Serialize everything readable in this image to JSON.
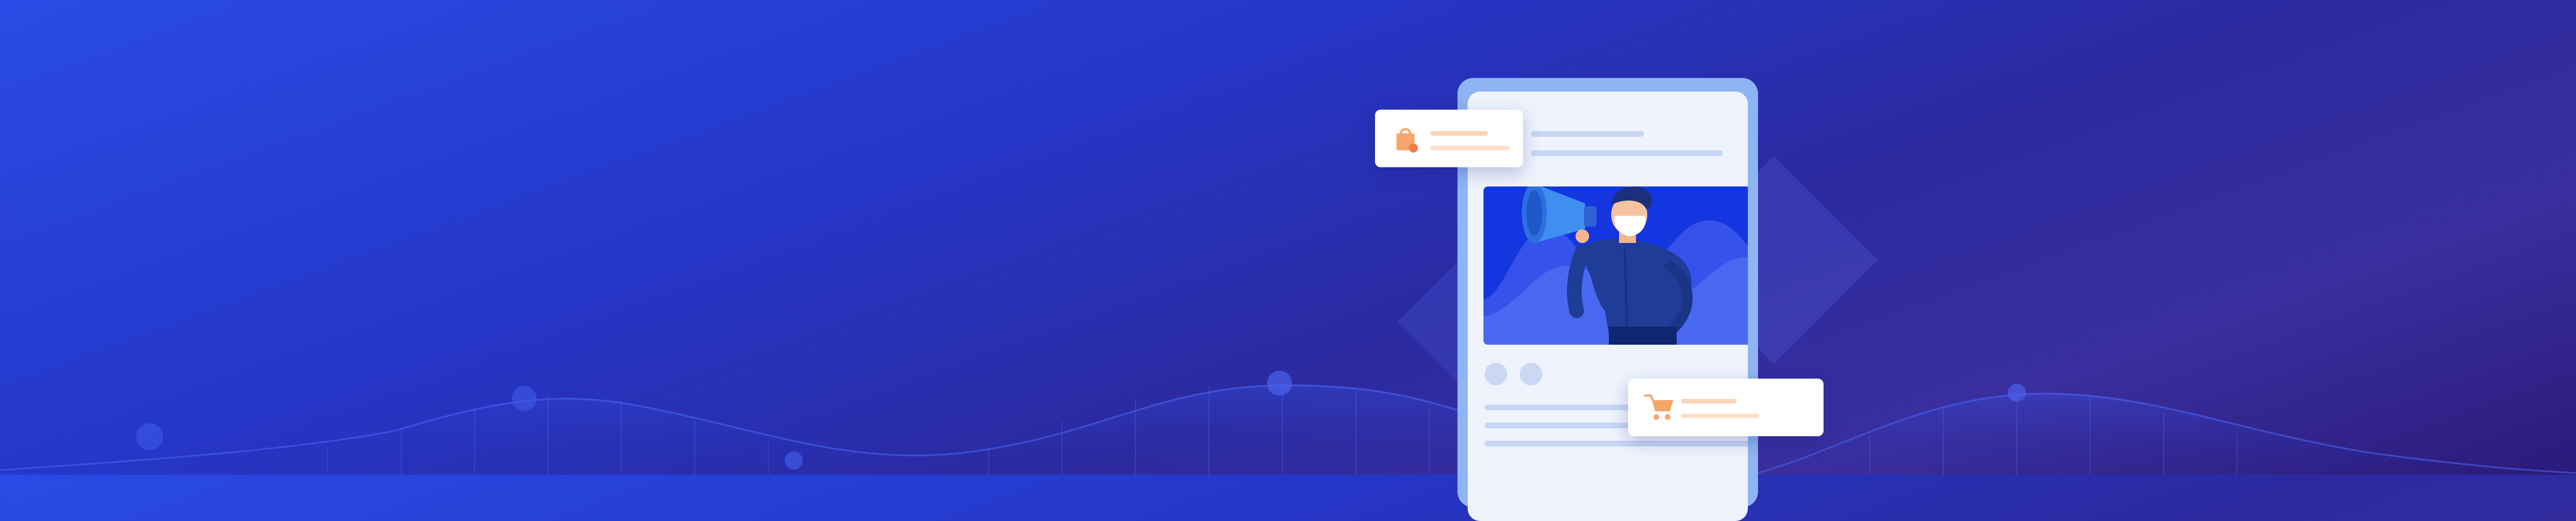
{
  "banner": {
    "background_colors": [
      "#2a4be6",
      "#2536c8",
      "#2b2aa0",
      "#3a2e9e",
      "#2a1a7a"
    ],
    "accent_color": "#f6a66b",
    "phone_color": "#8fb4f4",
    "screen_color": "#eef3fd",
    "hero_color": "#1436e0"
  },
  "illustration": {
    "subject": "megaphone-person-icon",
    "cards": [
      {
        "icon": "shopping-bag-icon"
      },
      {
        "icon": "shopping-cart-icon"
      }
    ]
  }
}
